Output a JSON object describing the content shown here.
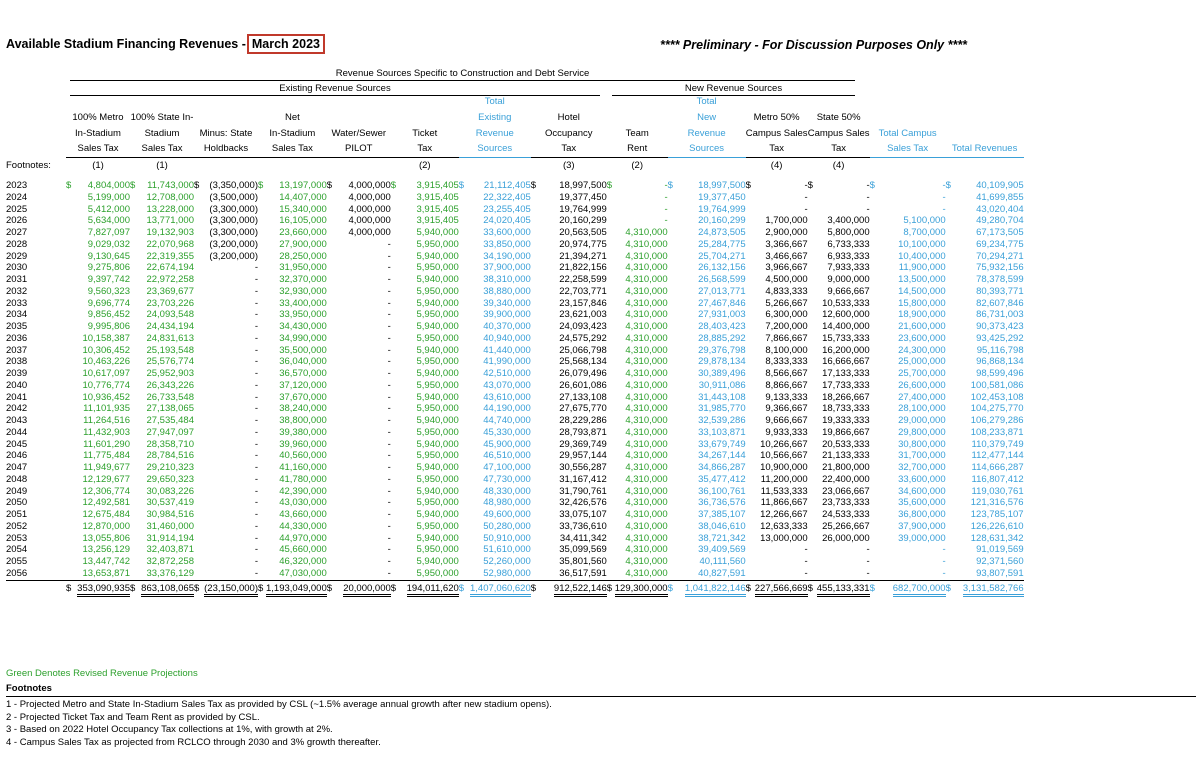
{
  "title": "Available Stadium Financing Revenues -",
  "title_date": "March 2023",
  "prelim": "**** Preliminary - For Discussion Purposes Only ****",
  "band_top": "Revenue Sources Specific to Construction and Debt Service",
  "band_existing": "Existing Revenue Sources",
  "band_new": "New Revenue Sources",
  "footnotes_label": "Footnotes:",
  "headers": [
    [
      "100% Metro",
      "In-Stadium",
      "Sales Tax"
    ],
    [
      "100% State In-",
      "Stadium",
      "Sales Tax"
    ],
    [
      "",
      "Minus:  State",
      "Holdbacks"
    ],
    [
      "Net",
      "In-Stadium",
      "Sales Tax"
    ],
    [
      "",
      "Water/Sewer",
      "PILOT"
    ],
    [
      "",
      "Ticket",
      "Tax"
    ],
    [
      "Total",
      "Existing",
      "Revenue",
      "Sources"
    ],
    [
      "Hotel",
      "Occupancy",
      "Tax"
    ],
    [
      "",
      "Team",
      "Rent"
    ],
    [
      "Total",
      "New",
      "Revenue",
      "Sources"
    ],
    [
      "Metro 50%",
      "Campus Sales",
      "Tax"
    ],
    [
      "State 50%",
      "Campus Sales",
      "Tax"
    ],
    [
      "",
      "Total Campus",
      "Sales Tax"
    ],
    [
      "",
      "",
      "Total Revenues"
    ]
  ],
  "footnote_refs": [
    "(1)",
    "(1)",
    "",
    "",
    "",
    "(2)",
    "",
    "(3)",
    "(2)",
    "",
    "(4)",
    "(4)",
    "",
    ""
  ],
  "rows": [
    [
      "2023",
      "$",
      "4,804,000",
      "$",
      "11,743,000",
      "$",
      "(3,350,000)",
      "$",
      "13,197,000",
      "$",
      "4,000,000",
      "$",
      "3,915,405",
      "$",
      "21,112,405",
      "$",
      "18,997,500",
      "$",
      "-",
      "$",
      "18,997,500",
      "$",
      "-",
      "$",
      "-",
      "$",
      "-",
      "$",
      "40,109,905"
    ],
    [
      "2024",
      "",
      "5,199,000",
      "",
      "12,708,000",
      "",
      "(3,500,000)",
      "",
      "14,407,000",
      "",
      "4,000,000",
      "",
      "3,915,405",
      "",
      "22,322,405",
      "",
      "19,377,450",
      "",
      "-",
      "",
      "19,377,450",
      "",
      "-",
      "",
      "-",
      "",
      "-",
      "",
      "41,699,855"
    ],
    [
      "2025",
      "",
      "5,412,000",
      "",
      "13,228,000",
      "",
      "(3,300,000)",
      "",
      "15,340,000",
      "",
      "4,000,000",
      "",
      "3,915,405",
      "",
      "23,255,405",
      "",
      "19,764,999",
      "",
      "-",
      "",
      "19,764,999",
      "",
      "-",
      "",
      "-",
      "",
      "-",
      "",
      "43,020,404"
    ],
    [
      "2026",
      "",
      "5,634,000",
      "",
      "13,771,000",
      "",
      "(3,300,000)",
      "",
      "16,105,000",
      "",
      "4,000,000",
      "",
      "3,915,405",
      "",
      "24,020,405",
      "",
      "20,160,299",
      "",
      "-",
      "",
      "20,160,299",
      "",
      "1,700,000",
      "",
      "3,400,000",
      "",
      "5,100,000",
      "",
      "49,280,704"
    ],
    [
      "2027",
      "",
      "7,827,097",
      "",
      "19,132,903",
      "",
      "(3,300,000)",
      "",
      "23,660,000",
      "",
      "4,000,000",
      "",
      "5,940,000",
      "",
      "33,600,000",
      "",
      "20,563,505",
      "",
      "4,310,000",
      "",
      "24,873,505",
      "",
      "2,900,000",
      "",
      "5,800,000",
      "",
      "8,700,000",
      "",
      "67,173,505"
    ],
    [
      "2028",
      "",
      "9,029,032",
      "",
      "22,070,968",
      "",
      "(3,200,000)",
      "",
      "27,900,000",
      "",
      "-",
      "",
      "5,950,000",
      "",
      "33,850,000",
      "",
      "20,974,775",
      "",
      "4,310,000",
      "",
      "25,284,775",
      "",
      "3,366,667",
      "",
      "6,733,333",
      "",
      "10,100,000",
      "",
      "69,234,775"
    ],
    [
      "2029",
      "",
      "9,130,645",
      "",
      "22,319,355",
      "",
      "(3,200,000)",
      "",
      "28,250,000",
      "",
      "-",
      "",
      "5,940,000",
      "",
      "34,190,000",
      "",
      "21,394,271",
      "",
      "4,310,000",
      "",
      "25,704,271",
      "",
      "3,466,667",
      "",
      "6,933,333",
      "",
      "10,400,000",
      "",
      "70,294,271"
    ],
    [
      "2030",
      "",
      "9,275,806",
      "",
      "22,674,194",
      "",
      "-",
      "",
      "31,950,000",
      "",
      "-",
      "",
      "5,950,000",
      "",
      "37,900,000",
      "",
      "21,822,156",
      "",
      "4,310,000",
      "",
      "26,132,156",
      "",
      "3,966,667",
      "",
      "7,933,333",
      "",
      "11,900,000",
      "",
      "75,932,156"
    ],
    [
      "2031",
      "",
      "9,397,742",
      "",
      "22,972,258",
      "",
      "-",
      "",
      "32,370,000",
      "",
      "-",
      "",
      "5,940,000",
      "",
      "38,310,000",
      "",
      "22,258,599",
      "",
      "4,310,000",
      "",
      "26,568,599",
      "",
      "4,500,000",
      "",
      "9,000,000",
      "",
      "13,500,000",
      "",
      "78,378,599"
    ],
    [
      "2032",
      "",
      "9,560,323",
      "",
      "23,369,677",
      "",
      "-",
      "",
      "32,930,000",
      "",
      "-",
      "",
      "5,950,000",
      "",
      "38,880,000",
      "",
      "22,703,771",
      "",
      "4,310,000",
      "",
      "27,013,771",
      "",
      "4,833,333",
      "",
      "9,666,667",
      "",
      "14,500,000",
      "",
      "80,393,771"
    ],
    [
      "2033",
      "",
      "9,696,774",
      "",
      "23,703,226",
      "",
      "-",
      "",
      "33,400,000",
      "",
      "-",
      "",
      "5,940,000",
      "",
      "39,340,000",
      "",
      "23,157,846",
      "",
      "4,310,000",
      "",
      "27,467,846",
      "",
      "5,266,667",
      "",
      "10,533,333",
      "",
      "15,800,000",
      "",
      "82,607,846"
    ],
    [
      "2034",
      "",
      "9,856,452",
      "",
      "24,093,548",
      "",
      "-",
      "",
      "33,950,000",
      "",
      "-",
      "",
      "5,950,000",
      "",
      "39,900,000",
      "",
      "23,621,003",
      "",
      "4,310,000",
      "",
      "27,931,003",
      "",
      "6,300,000",
      "",
      "12,600,000",
      "",
      "18,900,000",
      "",
      "86,731,003"
    ],
    [
      "2035",
      "",
      "9,995,806",
      "",
      "24,434,194",
      "",
      "-",
      "",
      "34,430,000",
      "",
      "-",
      "",
      "5,940,000",
      "",
      "40,370,000",
      "",
      "24,093,423",
      "",
      "4,310,000",
      "",
      "28,403,423",
      "",
      "7,200,000",
      "",
      "14,400,000",
      "",
      "21,600,000",
      "",
      "90,373,423"
    ],
    [
      "2036",
      "",
      "10,158,387",
      "",
      "24,831,613",
      "",
      "-",
      "",
      "34,990,000",
      "",
      "-",
      "",
      "5,950,000",
      "",
      "40,940,000",
      "",
      "24,575,292",
      "",
      "4,310,000",
      "",
      "28,885,292",
      "",
      "7,866,667",
      "",
      "15,733,333",
      "",
      "23,600,000",
      "",
      "93,425,292"
    ],
    [
      "2037",
      "",
      "10,306,452",
      "",
      "25,193,548",
      "",
      "-",
      "",
      "35,500,000",
      "",
      "-",
      "",
      "5,940,000",
      "",
      "41,440,000",
      "",
      "25,066,798",
      "",
      "4,310,000",
      "",
      "29,376,798",
      "",
      "8,100,000",
      "",
      "16,200,000",
      "",
      "24,300,000",
      "",
      "95,116,798"
    ],
    [
      "2038",
      "",
      "10,463,226",
      "",
      "25,576,774",
      "",
      "-",
      "",
      "36,040,000",
      "",
      "-",
      "",
      "5,950,000",
      "",
      "41,990,000",
      "",
      "25,568,134",
      "",
      "4,310,000",
      "",
      "29,878,134",
      "",
      "8,333,333",
      "",
      "16,666,667",
      "",
      "25,000,000",
      "",
      "96,868,134"
    ],
    [
      "2039",
      "",
      "10,617,097",
      "",
      "25,952,903",
      "",
      "-",
      "",
      "36,570,000",
      "",
      "-",
      "",
      "5,940,000",
      "",
      "42,510,000",
      "",
      "26,079,496",
      "",
      "4,310,000",
      "",
      "30,389,496",
      "",
      "8,566,667",
      "",
      "17,133,333",
      "",
      "25,700,000",
      "",
      "98,599,496"
    ],
    [
      "2040",
      "",
      "10,776,774",
      "",
      "26,343,226",
      "",
      "-",
      "",
      "37,120,000",
      "",
      "-",
      "",
      "5,950,000",
      "",
      "43,070,000",
      "",
      "26,601,086",
      "",
      "4,310,000",
      "",
      "30,911,086",
      "",
      "8,866,667",
      "",
      "17,733,333",
      "",
      "26,600,000",
      "",
      "100,581,086"
    ],
    [
      "2041",
      "",
      "10,936,452",
      "",
      "26,733,548",
      "",
      "-",
      "",
      "37,670,000",
      "",
      "-",
      "",
      "5,940,000",
      "",
      "43,610,000",
      "",
      "27,133,108",
      "",
      "4,310,000",
      "",
      "31,443,108",
      "",
      "9,133,333",
      "",
      "18,266,667",
      "",
      "27,400,000",
      "",
      "102,453,108"
    ],
    [
      "2042",
      "",
      "11,101,935",
      "",
      "27,138,065",
      "",
      "-",
      "",
      "38,240,000",
      "",
      "-",
      "",
      "5,950,000",
      "",
      "44,190,000",
      "",
      "27,675,770",
      "",
      "4,310,000",
      "",
      "31,985,770",
      "",
      "9,366,667",
      "",
      "18,733,333",
      "",
      "28,100,000",
      "",
      "104,275,770"
    ],
    [
      "2043",
      "",
      "11,264,516",
      "",
      "27,535,484",
      "",
      "-",
      "",
      "38,800,000",
      "",
      "-",
      "",
      "5,940,000",
      "",
      "44,740,000",
      "",
      "28,229,286",
      "",
      "4,310,000",
      "",
      "32,539,286",
      "",
      "9,666,667",
      "",
      "19,333,333",
      "",
      "29,000,000",
      "",
      "106,279,286"
    ],
    [
      "2044",
      "",
      "11,432,903",
      "",
      "27,947,097",
      "",
      "-",
      "",
      "39,380,000",
      "",
      "-",
      "",
      "5,950,000",
      "",
      "45,330,000",
      "",
      "28,793,871",
      "",
      "4,310,000",
      "",
      "33,103,871",
      "",
      "9,933,333",
      "",
      "19,866,667",
      "",
      "29,800,000",
      "",
      "108,233,871"
    ],
    [
      "2045",
      "",
      "11,601,290",
      "",
      "28,358,710",
      "",
      "-",
      "",
      "39,960,000",
      "",
      "-",
      "",
      "5,940,000",
      "",
      "45,900,000",
      "",
      "29,369,749",
      "",
      "4,310,000",
      "",
      "33,679,749",
      "",
      "10,266,667",
      "",
      "20,533,333",
      "",
      "30,800,000",
      "",
      "110,379,749"
    ],
    [
      "2046",
      "",
      "11,775,484",
      "",
      "28,784,516",
      "",
      "-",
      "",
      "40,560,000",
      "",
      "-",
      "",
      "5,950,000",
      "",
      "46,510,000",
      "",
      "29,957,144",
      "",
      "4,310,000",
      "",
      "34,267,144",
      "",
      "10,566,667",
      "",
      "21,133,333",
      "",
      "31,700,000",
      "",
      "112,477,144"
    ],
    [
      "2047",
      "",
      "11,949,677",
      "",
      "29,210,323",
      "",
      "-",
      "",
      "41,160,000",
      "",
      "-",
      "",
      "5,940,000",
      "",
      "47,100,000",
      "",
      "30,556,287",
      "",
      "4,310,000",
      "",
      "34,866,287",
      "",
      "10,900,000",
      "",
      "21,800,000",
      "",
      "32,700,000",
      "",
      "114,666,287"
    ],
    [
      "2048",
      "",
      "12,129,677",
      "",
      "29,650,323",
      "",
      "-",
      "",
      "41,780,000",
      "",
      "-",
      "",
      "5,950,000",
      "",
      "47,730,000",
      "",
      "31,167,412",
      "",
      "4,310,000",
      "",
      "35,477,412",
      "",
      "11,200,000",
      "",
      "22,400,000",
      "",
      "33,600,000",
      "",
      "116,807,412"
    ],
    [
      "2049",
      "",
      "12,306,774",
      "",
      "30,083,226",
      "",
      "-",
      "",
      "42,390,000",
      "",
      "-",
      "",
      "5,940,000",
      "",
      "48,330,000",
      "",
      "31,790,761",
      "",
      "4,310,000",
      "",
      "36,100,761",
      "",
      "11,533,333",
      "",
      "23,066,667",
      "",
      "34,600,000",
      "",
      "119,030,761"
    ],
    [
      "2050",
      "",
      "12,492,581",
      "",
      "30,537,419",
      "",
      "-",
      "",
      "43,030,000",
      "",
      "-",
      "",
      "5,950,000",
      "",
      "48,980,000",
      "",
      "32,426,576",
      "",
      "4,310,000",
      "",
      "36,736,576",
      "",
      "11,866,667",
      "",
      "23,733,333",
      "",
      "35,600,000",
      "",
      "121,316,576"
    ],
    [
      "2051",
      "",
      "12,675,484",
      "",
      "30,984,516",
      "",
      "-",
      "",
      "43,660,000",
      "",
      "-",
      "",
      "5,940,000",
      "",
      "49,600,000",
      "",
      "33,075,107",
      "",
      "4,310,000",
      "",
      "37,385,107",
      "",
      "12,266,667",
      "",
      "24,533,333",
      "",
      "36,800,000",
      "",
      "123,785,107"
    ],
    [
      "2052",
      "",
      "12,870,000",
      "",
      "31,460,000",
      "",
      "-",
      "",
      "44,330,000",
      "",
      "-",
      "",
      "5,950,000",
      "",
      "50,280,000",
      "",
      "33,736,610",
      "",
      "4,310,000",
      "",
      "38,046,610",
      "",
      "12,633,333",
      "",
      "25,266,667",
      "",
      "37,900,000",
      "",
      "126,226,610"
    ],
    [
      "2053",
      "",
      "13,055,806",
      "",
      "31,914,194",
      "",
      "-",
      "",
      "44,970,000",
      "",
      "-",
      "",
      "5,940,000",
      "",
      "50,910,000",
      "",
      "34,411,342",
      "",
      "4,310,000",
      "",
      "38,721,342",
      "",
      "13,000,000",
      "",
      "26,000,000",
      "",
      "39,000,000",
      "",
      "128,631,342"
    ],
    [
      "2054",
      "",
      "13,256,129",
      "",
      "32,403,871",
      "",
      "-",
      "",
      "45,660,000",
      "",
      "-",
      "",
      "5,950,000",
      "",
      "51,610,000",
      "",
      "35,099,569",
      "",
      "4,310,000",
      "",
      "39,409,569",
      "",
      "-",
      "",
      "-",
      "",
      "-",
      "",
      "91,019,569"
    ],
    [
      "2055",
      "",
      "13,447,742",
      "",
      "32,872,258",
      "",
      "-",
      "",
      "46,320,000",
      "",
      "-",
      "",
      "5,940,000",
      "",
      "52,260,000",
      "",
      "35,801,560",
      "",
      "4,310,000",
      "",
      "40,111,560",
      "",
      "-",
      "",
      "-",
      "",
      "-",
      "",
      "92,371,560"
    ],
    [
      "2056",
      "",
      "13,653,871",
      "",
      "33,376,129",
      "",
      "-",
      "",
      "47,030,000",
      "",
      "-",
      "",
      "5,950,000",
      "",
      "52,980,000",
      "",
      "36,517,591",
      "",
      "4,310,000",
      "",
      "40,827,591",
      "",
      "-",
      "",
      "-",
      "",
      "-",
      "",
      "93,807,591"
    ]
  ],
  "totals": [
    "",
    "$",
    "353,090,935",
    "$",
    "863,108,065",
    "$",
    "(23,150,000)",
    "$",
    "1,193,049,000",
    "$",
    "20,000,000",
    "$",
    "194,011,620",
    "$",
    "1,407,060,620",
    "$",
    "912,522,146",
    "$",
    "129,300,000",
    "$",
    "1,041,822,146",
    "$",
    "227,566,669",
    "$",
    "455,133,331",
    "$",
    "682,700,000",
    "$",
    "3,131,582,766"
  ],
  "green_note": "Green Denotes Revised Revenue Projections",
  "notes_heading": "Footnotes",
  "notes": [
    "1 - Projected Metro and State In-Stadium Sales Tax as provided by CSL (~1.5% average annual growth after new stadium opens).",
    "2 - Projected Ticket Tax and Team Rent as provided by CSL.",
    "3 - Based on 2022 Hotel Occupancy Tax collections at 1%, with growth at 2%.",
    "4 - Campus Sales Tax as projected from RCLCO through 2030 and 3% growth thereafter."
  ],
  "colors": {
    "green": "#2ca02c",
    "blue": "#3aa0d8",
    "date_box": "#c0392b"
  }
}
